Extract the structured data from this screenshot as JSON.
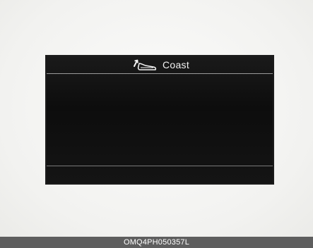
{
  "display": {
    "mode_icon": "coast-pedal-icon",
    "mode_label": "Coast"
  },
  "caption": {
    "code": "OMQ4PH050357L"
  }
}
